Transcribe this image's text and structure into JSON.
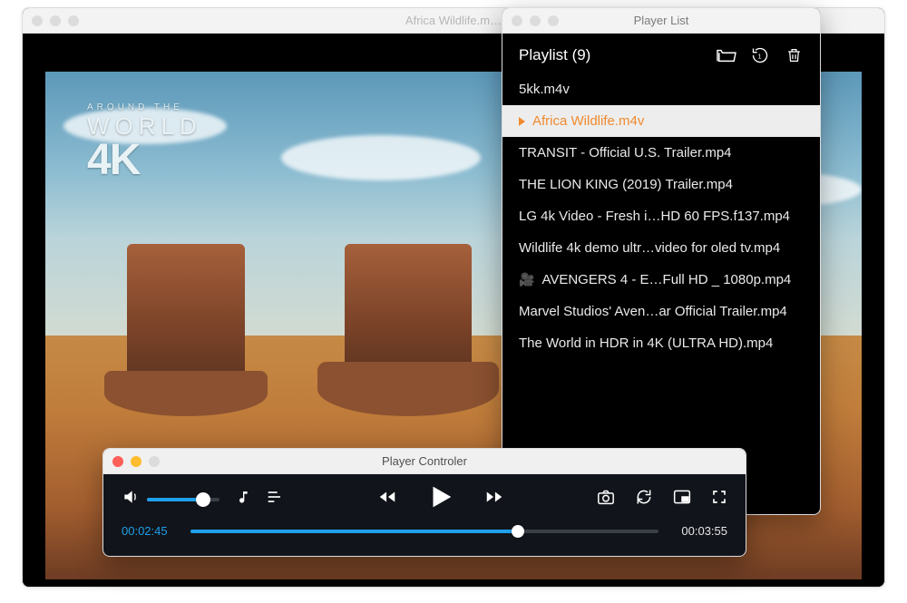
{
  "mainWindow": {
    "title": "Africa Wildlife.m…"
  },
  "playlistWindow": {
    "title": "Player List",
    "header": "Playlist (9)",
    "items": [
      {
        "name": "5kk.m4v",
        "active": false
      },
      {
        "name": "Africa Wildlife.m4v",
        "active": true
      },
      {
        "name": "TRANSIT - Official U.S. Trailer.mp4",
        "active": false
      },
      {
        "name": "THE LION KING (2019) Trailer.mp4",
        "active": false
      },
      {
        "name": "LG 4k Video - Fresh i…HD 60 FPS.f137.mp4",
        "active": false
      },
      {
        "name": "Wildlife 4k demo ultr…video for oled tv.mp4",
        "active": false
      },
      {
        "name": "AVENGERS 4 - E…Full HD _ 1080p.mp4",
        "active": false,
        "cameraIcon": true
      },
      {
        "name": "Marvel Studios' Aven…ar Official Trailer.mp4",
        "active": false
      },
      {
        "name": "The World in HDR in 4K (ULTRA HD).mp4",
        "active": false
      }
    ]
  },
  "controller": {
    "title": "Player Controler",
    "volumePercent": 78,
    "currentTime": "00:02:45",
    "duration": "00:03:55",
    "progressPercent": 70
  },
  "logo": {
    "line1": "AROUND THE",
    "line2": "WORLD",
    "line3": "4K"
  },
  "colors": {
    "accent": "#1ea0ec",
    "highlight": "#f08a2e"
  }
}
